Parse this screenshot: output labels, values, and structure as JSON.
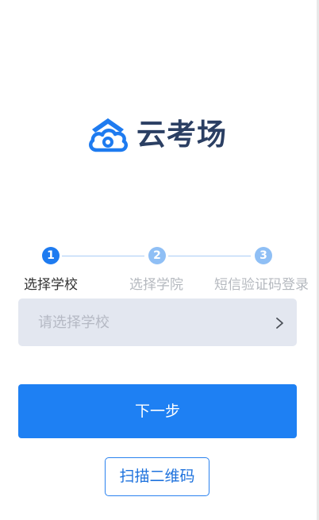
{
  "brand": {
    "name": "云考场",
    "color": "#2b3f63",
    "icon_color": "#1e7bf0"
  },
  "stepper": {
    "steps": [
      {
        "number": "1",
        "label": "选择学校",
        "state": "active"
      },
      {
        "number": "2",
        "label": "选择学院",
        "state": "inactive"
      },
      {
        "number": "3",
        "label": "短信验证码登录",
        "state": "inactive"
      }
    ]
  },
  "school_select": {
    "placeholder": "请选择学校",
    "icon": "chevron-right-icon"
  },
  "actions": {
    "next_label": "下一步",
    "scan_qr_label": "扫描二维码"
  },
  "colors": {
    "primary": "#1e80f3",
    "step_active": "#1e7bf0",
    "step_inactive": "#8fbff5",
    "select_bg": "#e3e7f0"
  }
}
